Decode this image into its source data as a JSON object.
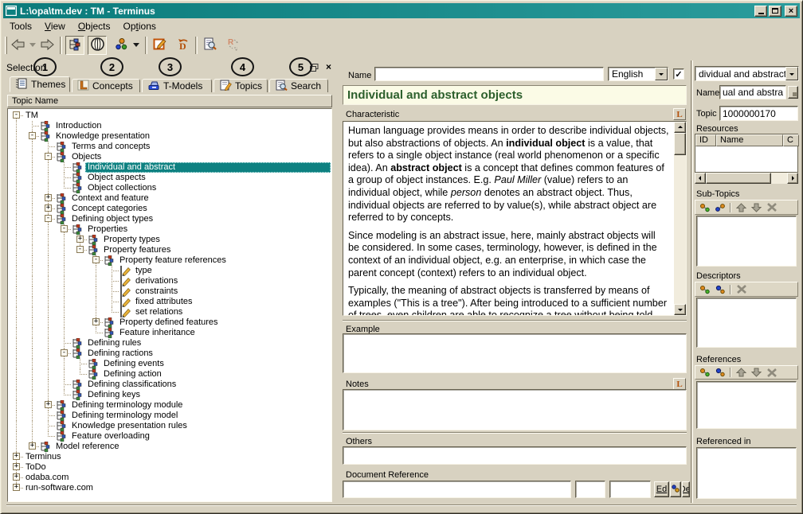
{
  "window": {
    "title": "L:\\opa\\tm.dev : TM - Terminus",
    "buttons": [
      "minimize",
      "maximize",
      "close"
    ]
  },
  "menu": {
    "items": [
      "Tools",
      "View",
      "Objects",
      "Options"
    ]
  },
  "toolbar": {
    "icons": [
      "back-arrow",
      "back-history-dropdown",
      "forward-arrow",
      "tree-view",
      "overview-globe",
      "relations-dots",
      "relations-dropdown",
      "edit-topic",
      "revert-document",
      "preview-document",
      "update-references"
    ]
  },
  "annotations": [
    "1",
    "2",
    "3",
    "4",
    "5"
  ],
  "selection_panel": {
    "title": "Selection",
    "tabs": [
      {
        "label": "Themes",
        "icon": "themes-notebook-icon"
      },
      {
        "label": "Concepts",
        "icon": "concepts-letter-icon"
      },
      {
        "label": "T-Models",
        "icon": "tmodels-device-icon"
      },
      {
        "label": "Topics",
        "icon": "topics-edit-icon"
      },
      {
        "label": "Search",
        "icon": "search-doc-icon"
      }
    ],
    "column_header": "Topic Name",
    "tree": [
      {
        "label": "TM",
        "level": 0,
        "box": "minus",
        "icon": null
      },
      {
        "label": "Introduction",
        "level": 1,
        "box": null,
        "icon": "node"
      },
      {
        "label": "Knowledge presentation",
        "level": 1,
        "box": "minus",
        "icon": "node"
      },
      {
        "label": "Terms and concepts",
        "level": 2,
        "box": null,
        "icon": "node"
      },
      {
        "label": "Objects",
        "level": 2,
        "box": "minus",
        "icon": "node"
      },
      {
        "label": "Individual and abstract",
        "level": 3,
        "box": null,
        "icon": "node",
        "selected": true
      },
      {
        "label": "Object aspects",
        "level": 3,
        "box": null,
        "icon": "node"
      },
      {
        "label": "Object collections",
        "level": 3,
        "box": null,
        "icon": "node"
      },
      {
        "label": "Context and feature",
        "level": 2,
        "box": "plus",
        "icon": "node"
      },
      {
        "label": "Concept categories",
        "level": 2,
        "box": "plus",
        "icon": "node"
      },
      {
        "label": "Defining object types",
        "level": 2,
        "box": "minus",
        "icon": "node"
      },
      {
        "label": "Properties",
        "level": 3,
        "box": "minus",
        "icon": "node"
      },
      {
        "label": "Property types",
        "level": 4,
        "box": "plus",
        "icon": "node"
      },
      {
        "label": "Property features",
        "level": 4,
        "box": "minus",
        "icon": "node"
      },
      {
        "label": "Property feature references",
        "level": 5,
        "box": "minus",
        "icon": "node"
      },
      {
        "label": "type",
        "level": 6,
        "box": null,
        "icon": "pencil"
      },
      {
        "label": "derivations",
        "level": 6,
        "box": null,
        "icon": "pencil"
      },
      {
        "label": "constraints",
        "level": 6,
        "box": null,
        "icon": "pencil"
      },
      {
        "label": "fixed attributes",
        "level": 6,
        "box": null,
        "icon": "pencil"
      },
      {
        "label": "set relations",
        "level": 6,
        "box": null,
        "icon": "pencil"
      },
      {
        "label": "Property defined features",
        "level": 5,
        "box": "plus",
        "icon": "node"
      },
      {
        "label": "Feature inheritance",
        "level": 5,
        "box": null,
        "icon": "node"
      },
      {
        "label": "Defining rules",
        "level": 3,
        "box": null,
        "icon": "node"
      },
      {
        "label": "Defining ractions",
        "level": 3,
        "box": "minus",
        "icon": "node"
      },
      {
        "label": "Defining events",
        "level": 4,
        "box": null,
        "icon": "node"
      },
      {
        "label": "Defining action",
        "level": 4,
        "box": null,
        "icon": "node"
      },
      {
        "label": "Defining classifications",
        "level": 3,
        "box": null,
        "icon": "node"
      },
      {
        "label": "Defining keys",
        "level": 3,
        "box": null,
        "icon": "node"
      },
      {
        "label": "Defining terminology module",
        "level": 2,
        "box": "plus",
        "icon": "node"
      },
      {
        "label": "Defining terminology model",
        "level": 2,
        "box": null,
        "icon": "node"
      },
      {
        "label": "Knowledge presentation rules",
        "level": 2,
        "box": null,
        "icon": "node"
      },
      {
        "label": "Feature overloading",
        "level": 2,
        "box": null,
        "icon": "node"
      },
      {
        "label": "Model reference",
        "level": 1,
        "box": "plus",
        "icon": "node"
      },
      {
        "label": "Terminus",
        "level": 0,
        "box": "plus",
        "icon": null
      },
      {
        "label": "ToDo",
        "level": 0,
        "box": "plus",
        "icon": null
      },
      {
        "label": "odaba.com",
        "level": 0,
        "box": "plus",
        "icon": null
      },
      {
        "label": "run-software.com",
        "level": 0,
        "box": "plus",
        "icon": null
      }
    ]
  },
  "editor": {
    "name_label": "Name",
    "name_value": "",
    "language_value": "English",
    "language_checked": "✓",
    "title": "Individual and abstract objects",
    "characteristic_label": "Characteristic",
    "characteristic_paragraphs": [
      [
        {
          "t": "Human language provides means in order to describe individual objects, but also abstractions of objects. An "
        },
        {
          "t": "individual object",
          "b": 1
        },
        {
          "t": " is a value, that refers to a single object instance (real world phenomenon or a specific idea). An "
        },
        {
          "t": "abstract object",
          "b": 1
        },
        {
          "t": " is a concept that defines common features of a group of object instances. E.g. "
        },
        {
          "t": "Paul Miller",
          "i": 1
        },
        {
          "t": " (value) refers to an individual object, while "
        },
        {
          "t": "person",
          "i": 1
        },
        {
          "t": " denotes an abstract object. Thus, individual objects are referred to by value(s), while abstract object are referred to by concepts."
        }
      ],
      [
        {
          "t": "Since modeling is an abstract issue, here, mainly abstract objects will be considered. In some cases, terminology, however, is defined in the context of an individual object, e.g. an enterprise, in which case the parent concept (context) refers to an individual object."
        }
      ],
      [
        {
          "t": "Typically, the meaning of abstract objects is transferred by means of examples (\"This is a tree\"). After being introduced to a sufficient number of trees, even children are able to recognize a tree without being told."
        }
      ]
    ],
    "example_label": "Example",
    "example_value": "",
    "notes_label": "Notes",
    "notes_value": "",
    "others_label": "Others",
    "others_value": "",
    "docref_label": "Document Reference",
    "docref_value": "",
    "docref_field2": "",
    "docref_field3": "",
    "edit_button": "Ed",
    "delete_button": "Del"
  },
  "topic_panel": {
    "selector_value": "dividual and abstract",
    "name_label": "Name",
    "name_value": "ual and abstract",
    "topic_label": "Topic",
    "topic_value": "1000000170",
    "resources_label": "Resources",
    "resources_columns": [
      "ID",
      "Name",
      "C"
    ],
    "subtopics_label": "Sub-Topics",
    "descriptors_label": "Descriptors",
    "references_label": "References",
    "referenced_in_label": "Referenced in",
    "list_toolbar_icons": [
      "add-link-icon",
      "add-topic-icon",
      "move-up-icon",
      "move-down-icon",
      "remove-icon"
    ]
  },
  "colors": {
    "title_bar": "#0e8181",
    "selection": "#0e8181",
    "title_band_bg": "#fbfbe6",
    "title_band_text": "#2c5f2c",
    "window_bg": "#d8d2c1"
  }
}
